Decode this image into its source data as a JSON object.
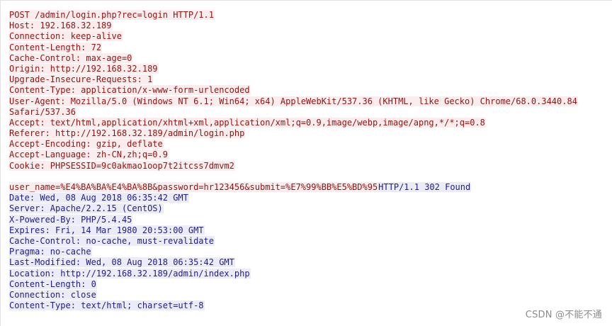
{
  "request": {
    "lines": [
      "POST /admin/login.php?rec=login HTTP/1.1",
      "Host: 192.168.32.189",
      "Connection: keep-alive",
      "Content-Length: 72",
      "Cache-Control: max-age=0",
      "Origin: http://192.168.32.189",
      "Upgrade-Insecure-Requests: 1",
      "Content-Type: application/x-www-form-urlencoded",
      "User-Agent: Mozilla/5.0 (Windows NT 6.1; Win64; x64) AppleWebKit/537.36 (KHTML, like Gecko) Chrome/68.0.3440.84",
      "Safari/537.36",
      "Accept: text/html,application/xhtml+xml,application/xml;q=0.9,image/webp,image/apng,*/*;q=0.8",
      "Referer: http://192.168.32.189/admin/login.php",
      "Accept-Encoding: gzip, deflate",
      "Accept-Language: zh-CN,zh;q=0.9",
      "Cookie: PHPSESSID=9c0akmao1oop7t2itcss7dmvm2"
    ],
    "body": "user_name=%E4%BA%BA%E4%BA%8B&password=hr123456&submit=%E7%99%BB%E5%BD%95"
  },
  "response": {
    "status_line": "HTTP/1.1 302 Found",
    "lines": [
      "Date: Wed, 08 Aug 2018 06:35:42 GMT",
      "Server: Apache/2.2.15 (CentOS)",
      "X-Powered-By: PHP/5.4.45",
      "Expires: Fri, 14 Mar 1980 20:53:00 GMT",
      "Cache-Control: no-cache, must-revalidate",
      "Pragma: no-cache",
      "Last-Modified: Wed, 08 Aug 2018 06:35:42 GMT",
      "Location: http://192.168.32.189/admin/index.php",
      "Content-Length: 0",
      "Connection: close",
      "Content-Type: text/html; charset=utf-8"
    ]
  },
  "watermark": "CSDN @不能不通",
  "colors": {
    "request_text": "#8e1512",
    "request_bg": "#fbeded",
    "response_text": "#1f1d8a",
    "response_bg": "#ececf8"
  }
}
